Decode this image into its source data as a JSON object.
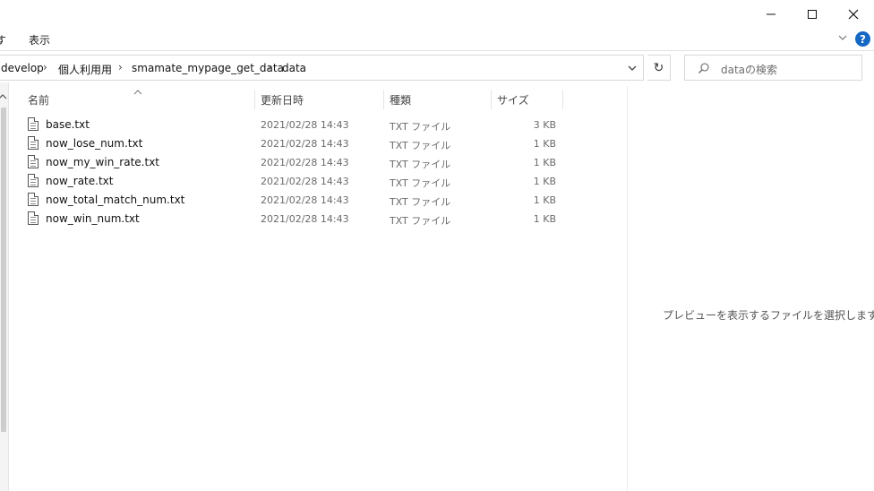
{
  "ribbon": {
    "tab_partial": "す",
    "tab_view": "表示"
  },
  "address": {
    "crumbs": [
      "develop",
      "個人利用用",
      "smamate_mypage_get_data",
      "data"
    ],
    "separator": "›"
  },
  "search": {
    "placeholder": "dataの検索"
  },
  "columns": {
    "name": "名前",
    "modified": "更新日時",
    "type": "種類",
    "size": "サイズ"
  },
  "files": [
    {
      "name": "base.txt",
      "modified": "2021/02/28 14:43",
      "type": "TXT ファイル",
      "size": "3 KB"
    },
    {
      "name": "now_lose_num.txt",
      "modified": "2021/02/28 14:43",
      "type": "TXT ファイル",
      "size": "1 KB"
    },
    {
      "name": "now_my_win_rate.txt",
      "modified": "2021/02/28 14:43",
      "type": "TXT ファイル",
      "size": "1 KB"
    },
    {
      "name": "now_rate.txt",
      "modified": "2021/02/28 14:43",
      "type": "TXT ファイル",
      "size": "1 KB"
    },
    {
      "name": "now_total_match_num.txt",
      "modified": "2021/02/28 14:43",
      "type": "TXT ファイル",
      "size": "1 KB"
    },
    {
      "name": "now_win_num.txt",
      "modified": "2021/02/28 14:43",
      "type": "TXT ファイル",
      "size": "1 KB"
    }
  ],
  "preview": {
    "message": "プレビューを表示するファイルを選択します。"
  },
  "icons": {
    "minimize": "minimize-icon",
    "maximize": "maximize-icon",
    "close": "close-icon",
    "help": "help-icon",
    "refresh": "refresh-icon",
    "search": "search-icon",
    "dropdown": "chevron-down-icon",
    "file": "text-file-icon"
  },
  "colors": {
    "help_accent": "#1668c5"
  }
}
